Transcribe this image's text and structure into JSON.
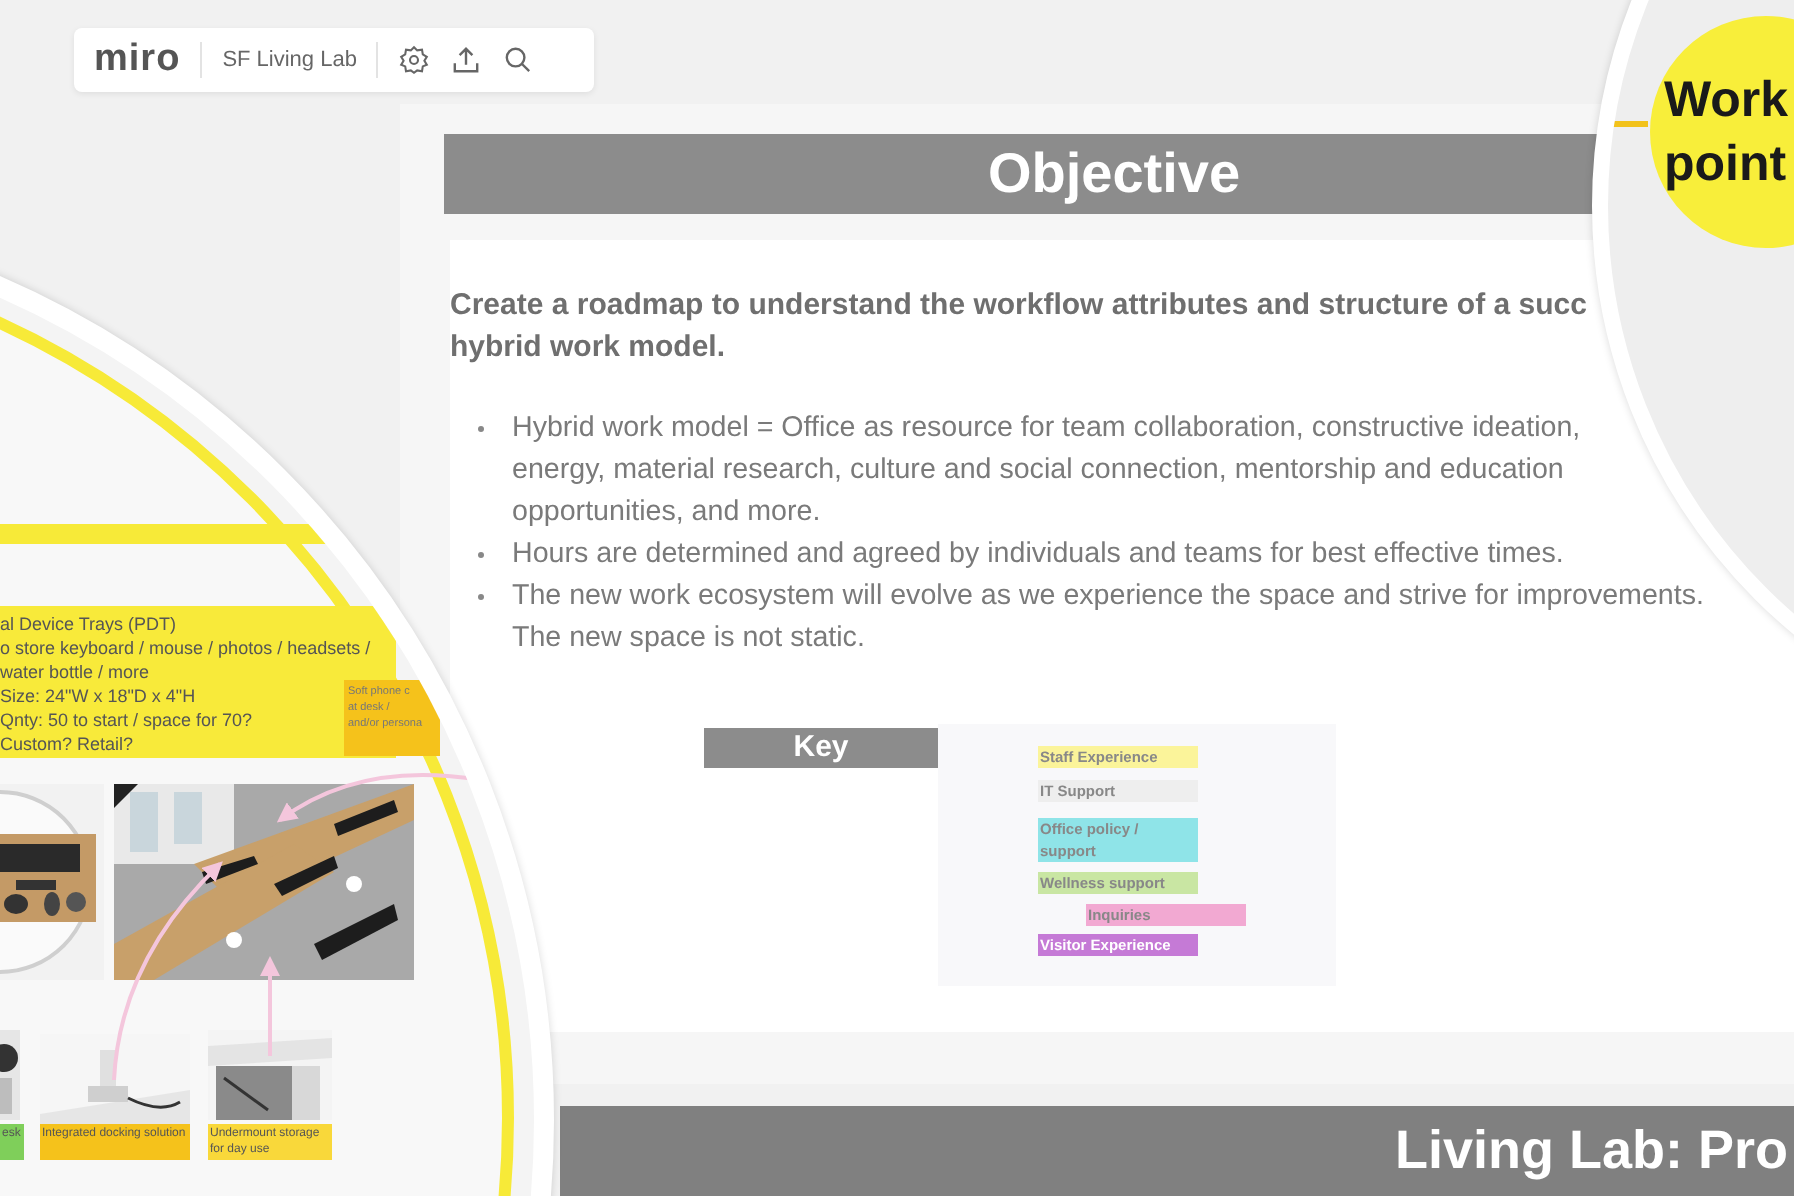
{
  "toolbar": {
    "logo": "miro",
    "board_name": "SF Living Lab"
  },
  "objective": {
    "title": "Objective",
    "statement_lines": [
      "Create a roadmap to understand the workflow attributes and structure of a succ",
      "hybrid work model."
    ],
    "bullets": [
      {
        "lines": [
          "Hybrid work model = Office as resource for team collaboration, constructive ideation,",
          "energy, material research, culture and social connection, mentorship and education",
          "opportunities, and more."
        ]
      },
      {
        "lines": [
          "Hours are determined and agreed by individuals and teams for best effective times."
        ]
      },
      {
        "lines": [
          "The new work ecosystem will evolve as we experience the space and strive for improvements.",
          "The new space is not static."
        ]
      }
    ]
  },
  "key": {
    "title": "Key",
    "entries": [
      {
        "label": "Staff Experience",
        "color": "#fbf49a"
      },
      {
        "label": "IT Support",
        "color": "#eeeeee"
      },
      {
        "label": "Office policy / support",
        "color": "#8fe4e8"
      },
      {
        "label": "Wellness support",
        "color": "#c9e6a3"
      },
      {
        "label": "Inquiries",
        "color": "#f2a9d2"
      },
      {
        "label": "Visitor Experience",
        "color": "#c57ad6"
      }
    ]
  },
  "lens": {
    "note_lines": [
      "al Device Trays (PDT)",
      "o store keyboard / mouse / photos / headsets /",
      "water bottle / more",
      "Size: 24\"W x 18\"D x 4\"H",
      "Qnty: 50 to start / space for 70?",
      "Custom? Retail?"
    ],
    "side_note_lines": [
      "Soft phone c",
      "at desk /",
      "and/or persona"
    ],
    "captions": [
      {
        "text": "esk",
        "color": "#7fcf5a"
      },
      {
        "text": "Integrated docking solution",
        "color": "#f5c21b"
      },
      {
        "text": "Undermount storage for day use",
        "color": "#f9d83a"
      }
    ]
  },
  "side_topic": {
    "lines": [
      "Work",
      "point"
    ]
  },
  "footer_title": "Living Lab: Pro"
}
